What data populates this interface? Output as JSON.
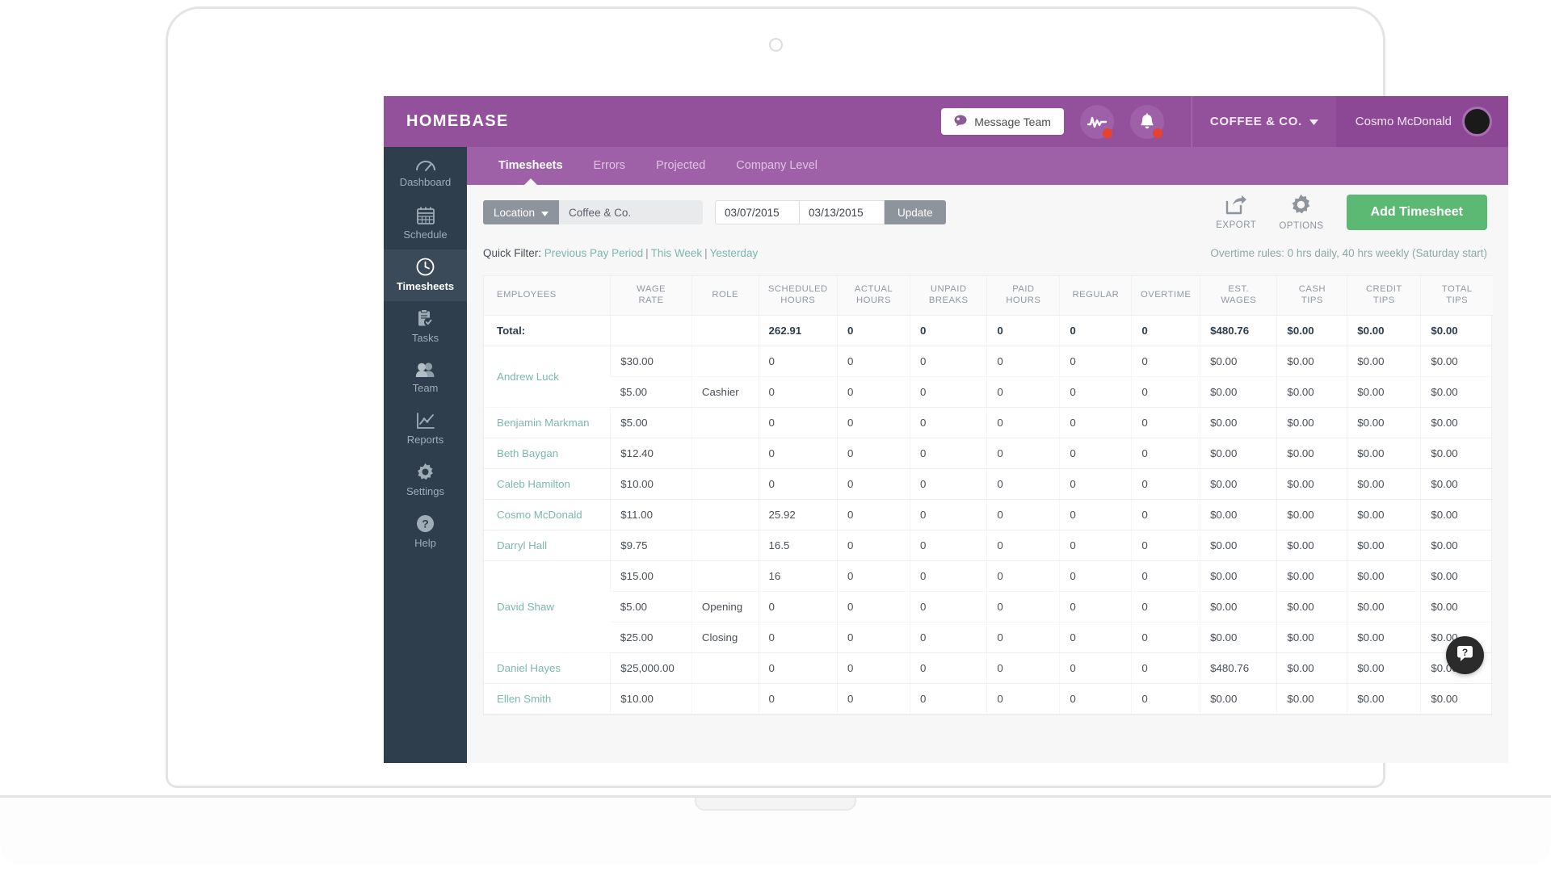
{
  "brand": {
    "logo": "HOMEBASE",
    "purple": "#94519b",
    "green": "#5bb974",
    "teal": "#7bb8ad",
    "sidebar_bg": "#2f3e4c"
  },
  "topbar": {
    "message_team": "Message Team",
    "activity_icon": "activity-pulse-icon",
    "bell_icon": "bell-icon",
    "company": "COFFEE & CO.",
    "user": "Cosmo McDonald"
  },
  "tabs": [
    {
      "label": "Timesheets",
      "active": true
    },
    {
      "label": "Errors",
      "active": false
    },
    {
      "label": "Projected",
      "active": false
    },
    {
      "label": "Company Level",
      "active": false
    }
  ],
  "sidebar": {
    "items": [
      {
        "label": "Dashboard",
        "icon": "gauge-icon",
        "active": false
      },
      {
        "label": "Schedule",
        "icon": "calendar-icon",
        "active": false
      },
      {
        "label": "Timesheets",
        "icon": "clock-icon",
        "active": true
      },
      {
        "label": "Tasks",
        "icon": "clipboard-check-icon",
        "active": false
      },
      {
        "label": "Team",
        "icon": "people-icon",
        "active": false
      },
      {
        "label": "Reports",
        "icon": "line-chart-icon",
        "active": false
      },
      {
        "label": "Settings",
        "icon": "gear-icon",
        "active": false
      },
      {
        "label": "Help",
        "icon": "question-circle-icon",
        "active": false
      }
    ]
  },
  "filterbar": {
    "location_label": "Location",
    "location_value": "Coffee & Co.",
    "date_start": "03/07/2015",
    "date_end": "03/13/2015",
    "update_label": "Update",
    "export_label": "EXPORT",
    "options_label": "OPTIONS",
    "add_timesheet_label": "Add Timesheet"
  },
  "quickfilter": {
    "label": "Quick Filter:",
    "links": [
      "Previous Pay Period",
      "This Week",
      "Yesterday"
    ],
    "separator": "|",
    "overtime_rules": "Overtime rules: 0 hrs daily, 40 hrs weekly (Saturday start)"
  },
  "table": {
    "columns": [
      "EMPLOYEES",
      "WAGE RATE",
      "ROLE",
      "SCHEDULED HOURS",
      "ACTUAL HOURS",
      "UNPAID BREAKS",
      "PAID HOURS",
      "REGULAR",
      "OVERTIME",
      "EST. WAGES",
      "CASH TIPS",
      "CREDIT TIPS",
      "TOTAL TIPS"
    ],
    "total_row": {
      "label": "Total:",
      "wage_rate": "",
      "role": "",
      "scheduled": "262.91",
      "actual": "0",
      "unpaid": "0",
      "paid": "0",
      "regular": "0",
      "overtime": "0",
      "est_wages": "$480.76",
      "cash_tips": "$0.00",
      "credit_tips": "$0.00",
      "total_tips": "$0.00"
    },
    "rows": [
      {
        "name": "Andrew Luck",
        "lines": [
          {
            "wage_rate": "$30.00",
            "role": "",
            "scheduled": "0",
            "actual": "0",
            "unpaid": "0",
            "paid": "0",
            "regular": "0",
            "overtime": "0",
            "est_wages": "$0.00",
            "cash_tips": "$0.00",
            "credit_tips": "$0.00",
            "total_tips": "$0.00"
          },
          {
            "wage_rate": "$5.00",
            "role": "Cashier",
            "scheduled": "0",
            "actual": "0",
            "unpaid": "0",
            "paid": "0",
            "regular": "0",
            "overtime": "0",
            "est_wages": "$0.00",
            "cash_tips": "$0.00",
            "credit_tips": "$0.00",
            "total_tips": "$0.00"
          }
        ]
      },
      {
        "name": "Benjamin Markman",
        "lines": [
          {
            "wage_rate": "$5.00",
            "role": "",
            "scheduled": "0",
            "actual": "0",
            "unpaid": "0",
            "paid": "0",
            "regular": "0",
            "overtime": "0",
            "est_wages": "$0.00",
            "cash_tips": "$0.00",
            "credit_tips": "$0.00",
            "total_tips": "$0.00"
          }
        ]
      },
      {
        "name": "Beth Baygan",
        "lines": [
          {
            "wage_rate": "$12.40",
            "role": "",
            "scheduled": "0",
            "actual": "0",
            "unpaid": "0",
            "paid": "0",
            "regular": "0",
            "overtime": "0",
            "est_wages": "$0.00",
            "cash_tips": "$0.00",
            "credit_tips": "$0.00",
            "total_tips": "$0.00"
          }
        ]
      },
      {
        "name": "Caleb Hamilton",
        "lines": [
          {
            "wage_rate": "$10.00",
            "role": "",
            "scheduled": "0",
            "actual": "0",
            "unpaid": "0",
            "paid": "0",
            "regular": "0",
            "overtime": "0",
            "est_wages": "$0.00",
            "cash_tips": "$0.00",
            "credit_tips": "$0.00",
            "total_tips": "$0.00"
          }
        ]
      },
      {
        "name": "Cosmo McDonald",
        "lines": [
          {
            "wage_rate": "$11.00",
            "role": "",
            "scheduled": "25.92",
            "actual": "0",
            "unpaid": "0",
            "paid": "0",
            "regular": "0",
            "overtime": "0",
            "est_wages": "$0.00",
            "cash_tips": "$0.00",
            "credit_tips": "$0.00",
            "total_tips": "$0.00"
          }
        ]
      },
      {
        "name": "Darryl Hall",
        "lines": [
          {
            "wage_rate": "$9.75",
            "role": "",
            "scheduled": "16.5",
            "actual": "0",
            "unpaid": "0",
            "paid": "0",
            "regular": "0",
            "overtime": "0",
            "est_wages": "$0.00",
            "cash_tips": "$0.00",
            "credit_tips": "$0.00",
            "total_tips": "$0.00"
          }
        ]
      },
      {
        "name": "David Shaw",
        "lines": [
          {
            "wage_rate": "$15.00",
            "role": "",
            "scheduled": "16",
            "actual": "0",
            "unpaid": "0",
            "paid": "0",
            "regular": "0",
            "overtime": "0",
            "est_wages": "$0.00",
            "cash_tips": "$0.00",
            "credit_tips": "$0.00",
            "total_tips": "$0.00"
          },
          {
            "wage_rate": "$5.00",
            "role": "Opening",
            "scheduled": "0",
            "actual": "0",
            "unpaid": "0",
            "paid": "0",
            "regular": "0",
            "overtime": "0",
            "est_wages": "$0.00",
            "cash_tips": "$0.00",
            "credit_tips": "$0.00",
            "total_tips": "$0.00"
          },
          {
            "wage_rate": "$25.00",
            "role": "Closing",
            "scheduled": "0",
            "actual": "0",
            "unpaid": "0",
            "paid": "0",
            "regular": "0",
            "overtime": "0",
            "est_wages": "$0.00",
            "cash_tips": "$0.00",
            "credit_tips": "$0.00",
            "total_tips": "$0.00"
          }
        ]
      },
      {
        "name": "Daniel Hayes",
        "lines": [
          {
            "wage_rate": "$25,000.00",
            "role": "",
            "scheduled": "0",
            "actual": "0",
            "unpaid": "0",
            "paid": "0",
            "regular": "0",
            "overtime": "0",
            "est_wages": "$480.76",
            "cash_tips": "$0.00",
            "credit_tips": "$0.00",
            "total_tips": "$0.00"
          }
        ]
      },
      {
        "name": "Ellen Smith",
        "lines": [
          {
            "wage_rate": "$10.00",
            "role": "",
            "scheduled": "0",
            "actual": "0",
            "unpaid": "0",
            "paid": "0",
            "regular": "0",
            "overtime": "0",
            "est_wages": "$0.00",
            "cash_tips": "$0.00",
            "credit_tips": "$0.00",
            "total_tips": "$0.00"
          }
        ]
      }
    ]
  },
  "help_widget": {
    "icon": "chat-question-icon"
  }
}
